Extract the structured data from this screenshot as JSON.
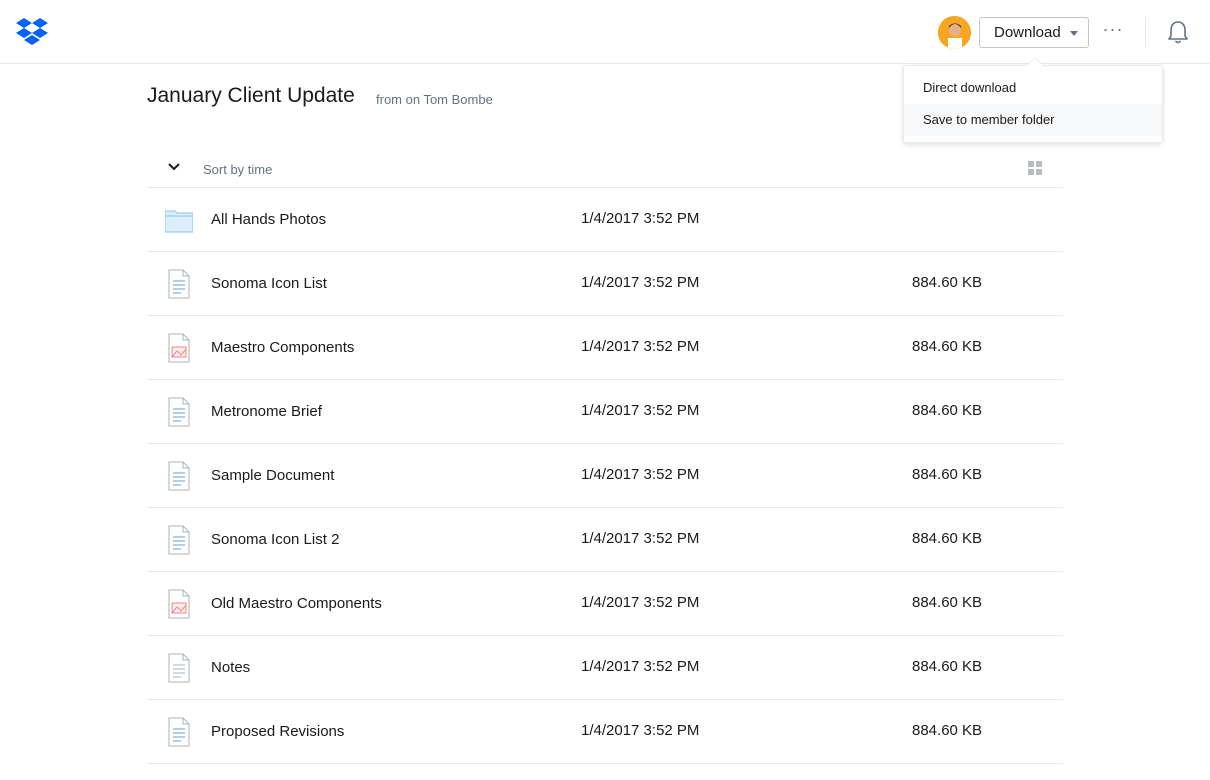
{
  "header": {
    "logo_icon": "dropbox-logo-icon",
    "download_label": "Download",
    "more_label": "···",
    "brand_color": "#0061fe"
  },
  "download_menu": {
    "items": [
      "Direct download",
      "Save to member folder"
    ]
  },
  "folder": {
    "title": "January Client Update",
    "subtitle": "from on Tom Bombe"
  },
  "sort": {
    "label": "Sort by time"
  },
  "files": [
    {
      "name": "All Hands Photos",
      "time": "1/4/2017 3:52 PM",
      "size": "",
      "icon": "folder-icon"
    },
    {
      "name": "Sonoma Icon List",
      "time": "1/4/2017 3:52 PM",
      "size": "884.60 KB",
      "icon": "document-icon"
    },
    {
      "name": "Maestro Components",
      "time": "1/4/2017 3:52 PM",
      "size": "884.60 KB",
      "icon": "image-file-icon"
    },
    {
      "name": "Metronome Brief",
      "time": "1/4/2017 3:52 PM",
      "size": "884.60 KB",
      "icon": "document-icon"
    },
    {
      "name": "Sample Document",
      "time": "1/4/2017 3:52 PM",
      "size": "884.60 KB",
      "icon": "document-icon"
    },
    {
      "name": "Sonoma Icon List 2",
      "time": "1/4/2017 3:52 PM",
      "size": "884.60 KB",
      "icon": "document-icon"
    },
    {
      "name": "Old Maestro Components",
      "time": "1/4/2017 3:52 PM",
      "size": "884.60 KB",
      "icon": "image-file-icon"
    },
    {
      "name": "Notes",
      "time": "1/4/2017 3:52 PM",
      "size": "884.60 KB",
      "icon": "text-file-icon"
    },
    {
      "name": "Proposed Revisions",
      "time": "1/4/2017 3:52 PM",
      "size": "884.60 KB",
      "icon": "document-icon"
    }
  ]
}
